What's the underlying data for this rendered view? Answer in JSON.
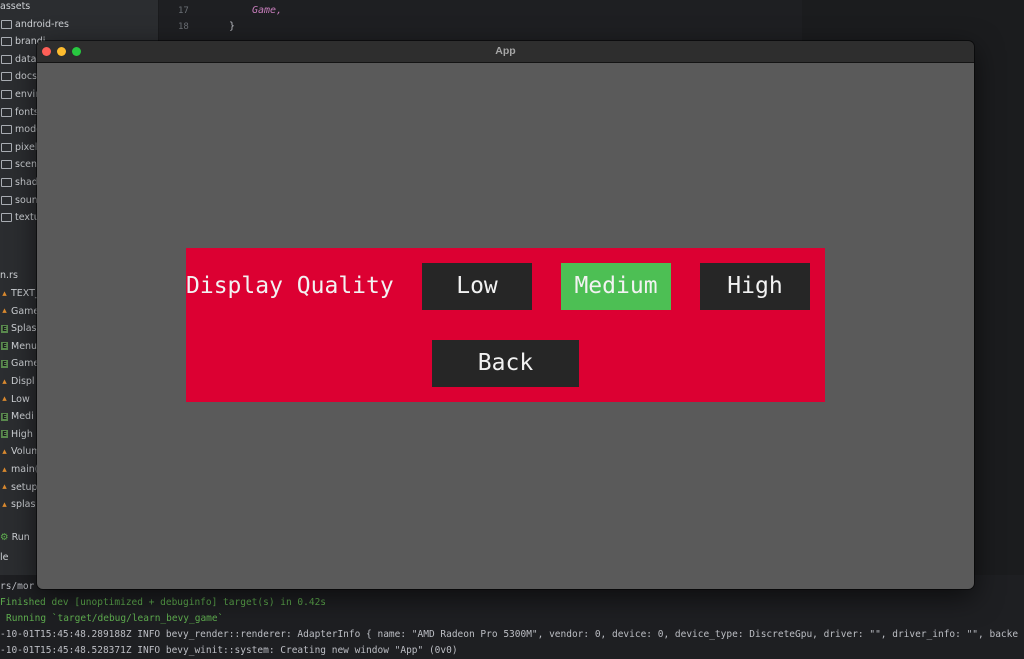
{
  "ide": {
    "tree": [
      {
        "label": "assets",
        "kind": "plain"
      },
      {
        "label": "android-res",
        "kind": "folder"
      },
      {
        "label": "brandi",
        "kind": "folder"
      },
      {
        "label": "data",
        "kind": "folder"
      },
      {
        "label": "docs",
        "kind": "folder"
      },
      {
        "label": "envir",
        "kind": "folder"
      },
      {
        "label": "fonts",
        "kind": "folder"
      },
      {
        "label": "mode",
        "kind": "folder"
      },
      {
        "label": "pixel",
        "kind": "folder"
      },
      {
        "label": "scen",
        "kind": "folder"
      },
      {
        "label": "shad",
        "kind": "folder"
      },
      {
        "label": "soun",
        "kind": "folder"
      },
      {
        "label": "textu",
        "kind": "folder"
      }
    ],
    "structure_file": "n.rs",
    "structure": [
      {
        "label": "TEXT_",
        "kind": "fn"
      },
      {
        "label": "Game",
        "kind": "fn"
      },
      {
        "label": "Splas",
        "kind": "struct"
      },
      {
        "label": "Menu",
        "kind": "struct"
      },
      {
        "label": "Game",
        "kind": "struct"
      },
      {
        "label": "Displ",
        "kind": "fn"
      },
      {
        "label": "Low",
        "kind": "fn"
      },
      {
        "label": "Medi",
        "kind": "struct"
      },
      {
        "label": "High",
        "kind": "struct"
      },
      {
        "label": "Volum",
        "kind": "fn"
      },
      {
        "label": "main(",
        "kind": "fn"
      },
      {
        "label": "setup",
        "kind": "fn"
      },
      {
        "label": "splas",
        "kind": "fn"
      }
    ],
    "run_label": "Run le",
    "code_lines": [
      {
        "no": "17",
        "text": "Game,"
      },
      {
        "no": "18",
        "text": "}"
      }
    ],
    "terminal": [
      "rs/mor",
      "Finished dev [unoptimized + debuginfo] target(s) in 0.42s",
      "Running `target/debug/learn_bevy_game`",
      "-10-01T15:45:48.289188Z  INFO bevy_render::renderer: AdapterInfo { name: \"AMD Radeon Pro 5300M\", vendor: 0, device: 0, device_type: DiscreteGpu, driver: \"\", driver_info: \"\", backe",
      "-10-01T15:45:48.528371Z  INFO bevy_winit::system: Creating new window \"App\" (0v0)"
    ]
  },
  "window": {
    "title": "App"
  },
  "menu": {
    "quality_label": "Display Quality",
    "options": {
      "low": "Low",
      "medium": "Medium",
      "high": "High"
    },
    "selected": "Medium",
    "back_label": "Back"
  },
  "colors": {
    "panel": "#dc0032",
    "button": "#262626",
    "selected_button": "#4dbf54",
    "viewport": "#5a5a5a"
  }
}
